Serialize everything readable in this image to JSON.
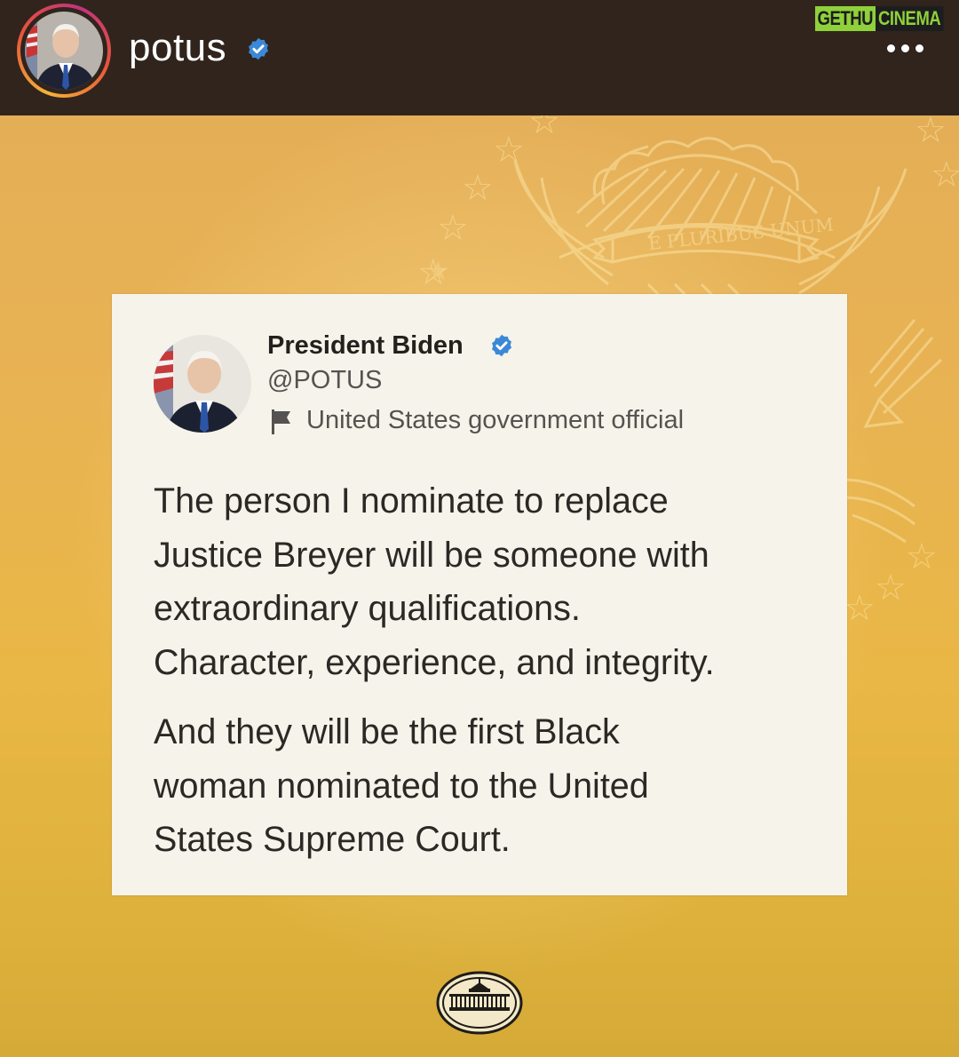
{
  "header": {
    "username": "potus",
    "verified_icon": "verified-badge-icon",
    "more_icon": "more-options-icon"
  },
  "watermark": {
    "left_text": "GETHU",
    "right_text": "CINEMA"
  },
  "tweet": {
    "display_name": "President Biden",
    "handle": "@POTUS",
    "label_icon": "flag-icon",
    "account_label": "United States government official",
    "paragraph_1": "The person I nominate to replace\nJustice Breyer will be someone with\nextraordinary qualifications.\nCharacter, experience, and integrity.",
    "paragraph_2": "And they will be the first Black\nwoman nominated to the United\nStates Supreme Court."
  },
  "seal_text": "E PLURIBUS UNUM",
  "colors": {
    "header_bg": "#30241c",
    "verified_blue": "#3b89d6",
    "card_bg": "#f6f3ea",
    "background_gold": "#e6b24c"
  },
  "footer_icon": "white-house-logo-icon"
}
